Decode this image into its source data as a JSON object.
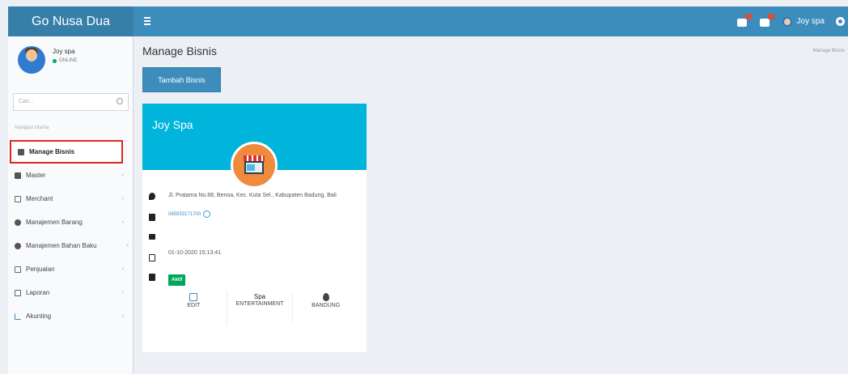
{
  "app": {
    "brand": "Go Nusa Dua"
  },
  "topbar": {
    "user": "Joy spa"
  },
  "sidebar": {
    "user": {
      "name": "Joy spa",
      "status": "ONLINE"
    },
    "search_placeholder": "Cari...",
    "nav_header": "Navigasi Utama",
    "items": [
      {
        "label": "Manage Bisnis",
        "icon": "file-icon"
      },
      {
        "label": "Master",
        "icon": "folder-icon"
      },
      {
        "label": "Merchant",
        "icon": "store-icon"
      },
      {
        "label": "Manajemen Barang",
        "icon": "box-icon"
      },
      {
        "label": "Manajemen Bahan Baku",
        "icon": "ingredients-icon"
      },
      {
        "label": "Penjualan",
        "icon": "cash-register-icon"
      },
      {
        "label": "Laporan",
        "icon": "report-icon"
      },
      {
        "label": "Akunting",
        "icon": "chart-icon"
      }
    ]
  },
  "content": {
    "title": "Manage Bisnis",
    "breadcrumb": "Manage Bisnis",
    "add_button": "Tambah Bisnis"
  },
  "card": {
    "title": "Joy Spa",
    "address": "Jl. Pratama No.88, Benoa, Kec. Kuta Sel., Kabupaten Badung, Bali",
    "phone": "085933171700",
    "datetime": "01-10-2020 15:13:41",
    "status": "Aktif",
    "stats": {
      "edit": "EDIT",
      "category_top": "Spa",
      "category_bottom": "ENTERTAINMENT",
      "city": "BANDUNG"
    }
  },
  "colors": {
    "primary": "#3c8dbc",
    "card_header": "#00b4dc",
    "active_border": "#e0271f",
    "success": "#00a65a"
  }
}
